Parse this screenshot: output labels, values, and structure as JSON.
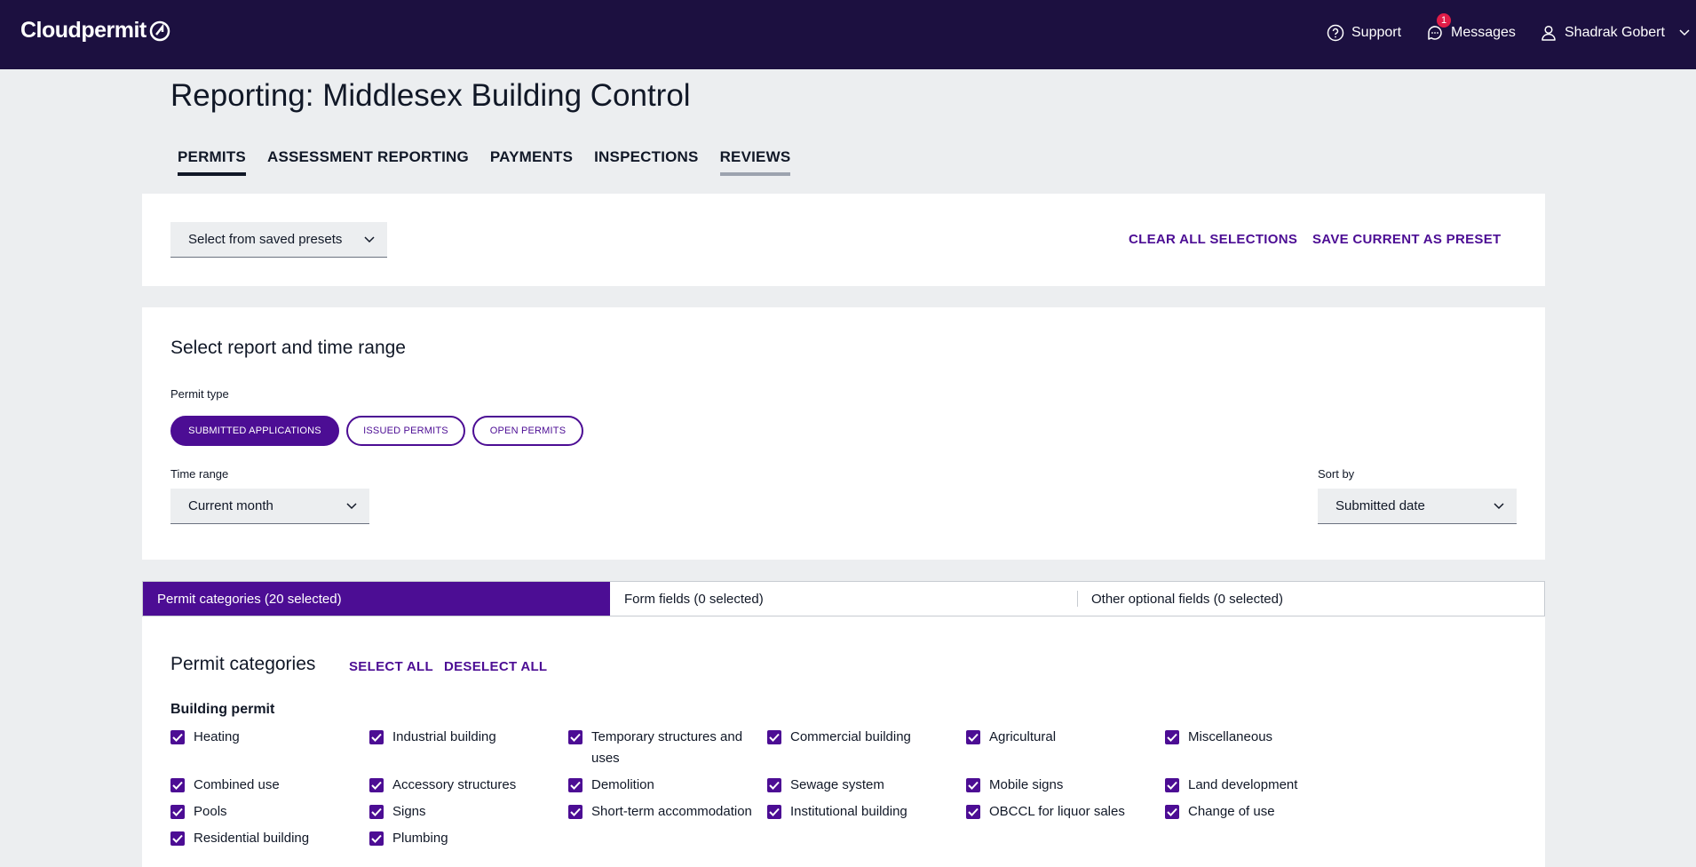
{
  "brand": {
    "name": "Cloudpermit"
  },
  "topnav": {
    "support": "Support",
    "messages": "Messages",
    "messages_badge": "1",
    "user": "Shadrak Gobert"
  },
  "page": {
    "title": "Reporting: Middlesex Building Control"
  },
  "tabs": [
    {
      "label": "PERMITS",
      "state": "active"
    },
    {
      "label": "ASSESSMENT REPORTING"
    },
    {
      "label": "PAYMENTS"
    },
    {
      "label": "INSPECTIONS"
    },
    {
      "label": "REVIEWS",
      "state": "hover"
    }
  ],
  "presets": {
    "select_label": "Select from saved presets",
    "clear_all": "CLEAR ALL SELECTIONS",
    "save_preset": "SAVE CURRENT AS PRESET"
  },
  "report": {
    "title": "Select report and time range",
    "permit_type_label": "Permit type",
    "permit_types": [
      {
        "label": "SUBMITTED APPLICATIONS",
        "active": true
      },
      {
        "label": "ISSUED PERMITS",
        "active": false
      },
      {
        "label": "OPEN PERMITS",
        "active": false
      }
    ],
    "time_range_label": "Time range",
    "time_range_value": "Current month",
    "sort_by_label": "Sort by",
    "sort_by_value": "Submitted date"
  },
  "segments": [
    {
      "label": "Permit categories (20 selected)",
      "active": true
    },
    {
      "label": "Form fields (0 selected)",
      "active": false
    },
    {
      "label": "Other optional fields (0 selected)",
      "active": false
    }
  ],
  "categories": {
    "title": "Permit categories",
    "select_all": "SELECT ALL",
    "deselect_all": "DESELECT ALL",
    "group_title": "Building permit",
    "items": [
      "Heating",
      "Industrial building",
      "Temporary structures and uses",
      "Commercial building",
      "Agricultural",
      "Miscellaneous",
      "Combined use",
      "Accessory structures",
      "Demolition",
      "Sewage system",
      "Mobile signs",
      "Land development",
      "Pools",
      "Signs",
      "Short-term accommodation",
      "Institutional building",
      "OBCCL for liquor sales",
      "Change of use",
      "Residential building",
      "Plumbing"
    ]
  },
  "colors": {
    "accent": "#4c0d94",
    "topbar": "#1c1040",
    "background": "#eceef0"
  }
}
